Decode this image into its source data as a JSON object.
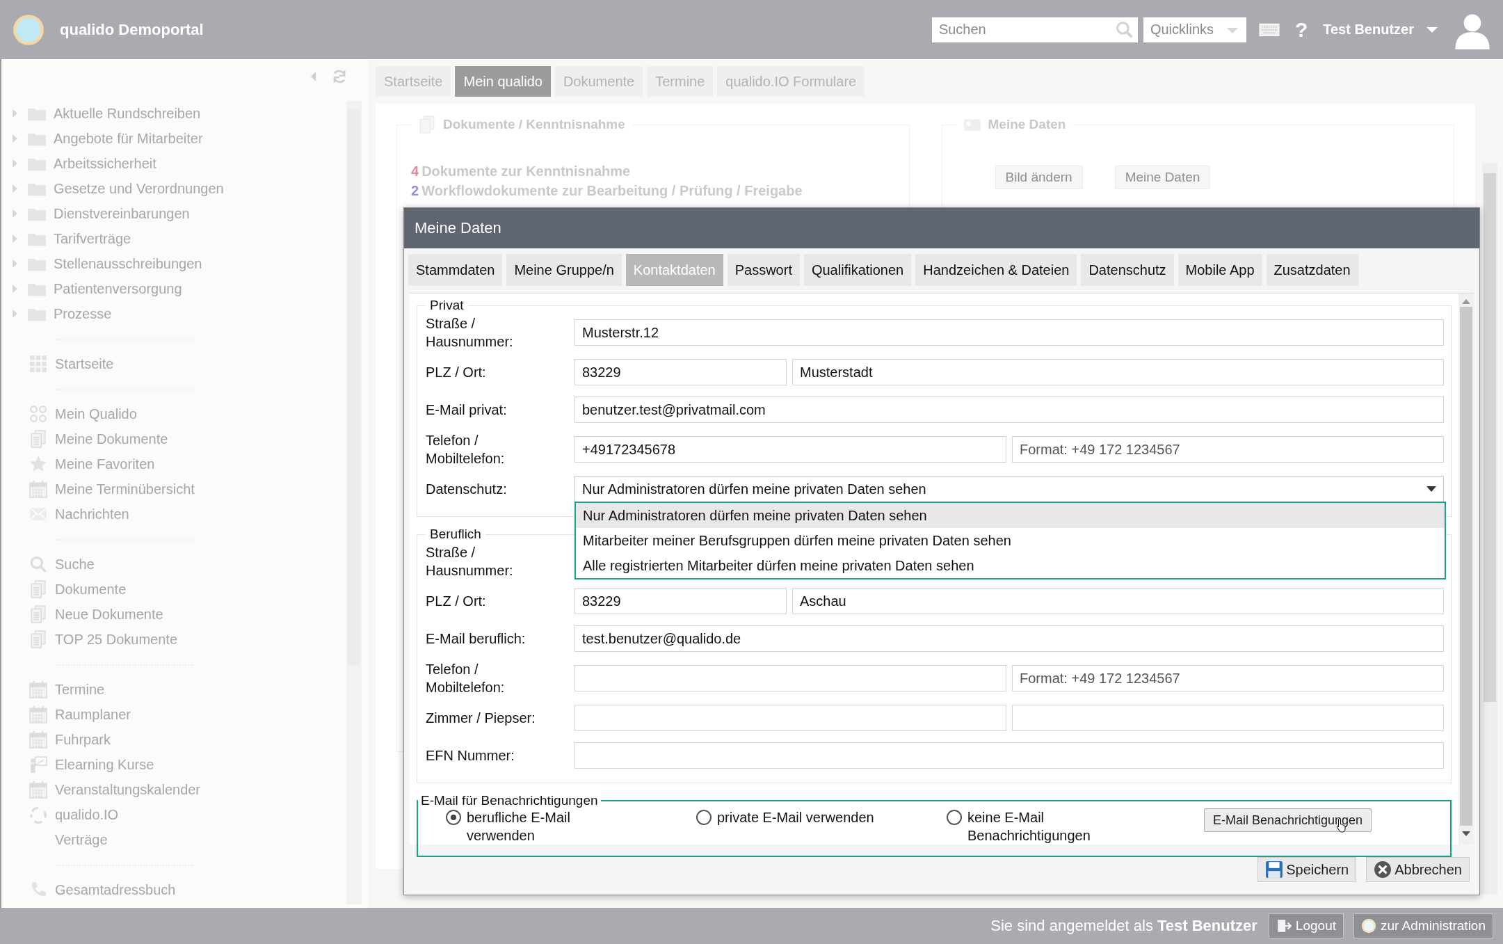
{
  "header": {
    "app_title": "qualido Demoportal",
    "search_placeholder": "Suchen",
    "quicklinks": "Quicklinks",
    "help": "?",
    "user": "Test Benutzer"
  },
  "sidebar": {
    "folders": [
      "Aktuelle Rundschreiben",
      "Angebote für Mitarbeiter",
      "Arbeitssicherheit",
      "Gesetze und Verordnungen",
      "Dienstvereinbarungen",
      "Tarifverträge",
      "Stellenausschreibungen",
      "Patientenversorgung",
      "Prozesse"
    ],
    "sections": [
      [
        {
          "label": "Startseite",
          "kind": "grid"
        }
      ],
      [
        {
          "label": "Mein Qualido",
          "kind": "circles"
        },
        {
          "label": "Meine Dokumente",
          "kind": "docs"
        },
        {
          "label": "Meine Favoriten",
          "kind": "star"
        },
        {
          "label": "Meine Terminübersicht",
          "kind": "calendar"
        },
        {
          "label": "Nachrichten",
          "kind": "mail"
        }
      ],
      [
        {
          "label": "Suche",
          "kind": "search"
        },
        {
          "label": "Dokumente",
          "kind": "docs"
        },
        {
          "label": "Neue Dokumente",
          "kind": "docs"
        },
        {
          "label": "TOP 25 Dokumente",
          "kind": "docs"
        }
      ],
      [
        {
          "label": "Termine",
          "kind": "calendar"
        },
        {
          "label": "Raumplaner",
          "kind": "calendar"
        },
        {
          "label": "Fuhrpark",
          "kind": "calendar"
        },
        {
          "label": "Elearning Kurse",
          "kind": "board"
        },
        {
          "label": "Veranstaltungskalender",
          "kind": "calendar"
        },
        {
          "label": "qualido.IO",
          "kind": "cycle"
        },
        {
          "label": "Verträge",
          "kind": "none"
        }
      ],
      [
        {
          "label": "Gesamtadressbuch",
          "kind": "phone"
        }
      ]
    ]
  },
  "main_tabs": [
    {
      "label": "Startseite",
      "selected": false
    },
    {
      "label": "Mein qualido",
      "selected": true
    },
    {
      "label": "Dokumente",
      "selected": false
    },
    {
      "label": "Termine",
      "selected": false
    },
    {
      "label": "qualido.IO Formulare",
      "selected": false
    }
  ],
  "panels": [
    {
      "title": "Dokumente / Kenntnisnahme",
      "kind": "docs",
      "lines": [
        {
          "count": "4",
          "text": "Dokumente zur Kenntnisnahme",
          "color": "#e58a98"
        },
        {
          "count": "2",
          "text": "Workflowdokumente zur Bearbeitung / Prüfung / Freigabe",
          "color": "#8f8fe0"
        }
      ]
    },
    {
      "title": "Meine Daten",
      "kind": "card",
      "buttons": [
        "Bild ändern",
        "Meine Daten"
      ]
    }
  ],
  "modal": {
    "title": "Meine Daten",
    "tabs": [
      {
        "label": "Stammdaten",
        "selected": false
      },
      {
        "label": "Meine Gruppe/n",
        "selected": false
      },
      {
        "label": "Kontaktdaten",
        "selected": true
      },
      {
        "label": "Passwort",
        "selected": false
      },
      {
        "label": "Qualifikationen",
        "selected": false
      },
      {
        "label": "Handzeichen & Dateien",
        "selected": false
      },
      {
        "label": "Datenschutz",
        "selected": false
      },
      {
        "label": "Mobile App",
        "selected": false
      },
      {
        "label": "Zusatzdaten",
        "selected": false
      }
    ],
    "sections": [
      {
        "legend": "Privat",
        "rows": [
          {
            "kind": "text",
            "label": "Straße / Hausnummer:",
            "value": "Musterstr.12"
          },
          {
            "kind": "zip",
            "label": "PLZ / Ort:",
            "value": "83229",
            "second_value": "Musterstadt"
          },
          {
            "kind": "text",
            "label": "E-Mail privat:",
            "value": "benutzer.test@privatmail.com"
          },
          {
            "kind": "pair",
            "label": "Telefon / Mobiltelefon:",
            "value": "+49172345678",
            "second_placeholder": "Format: +49 172 1234567"
          },
          {
            "kind": "select",
            "label": "Datenschutz:",
            "value": "Nur Administratoren dürfen meine privaten Daten sehen",
            "expanded": true,
            "options": [
              {
                "label": "Nur Administratoren dürfen meine privaten Daten sehen",
                "selected": true
              },
              {
                "label": "Mitarbeiter meiner Berufsgruppen dürfen meine privaten Daten sehen",
                "selected": false
              },
              {
                "label": "Alle registrierten Mitarbeiter dürfen meine privaten Daten sehen",
                "selected": false
              }
            ]
          }
        ]
      },
      {
        "legend": "Beruflich",
        "rows": [
          {
            "kind": "label",
            "label": "Straße / Hausnummer:"
          },
          {
            "kind": "zip",
            "label": "PLZ / Ort:",
            "value": "83229",
            "second_value": "Aschau"
          },
          {
            "kind": "text",
            "label": "E-Mail beruflich:",
            "value": "test.benutzer@qualido.de"
          },
          {
            "kind": "pair",
            "label": "Telefon / Mobiltelefon:",
            "second_placeholder": "Format: +49 172 1234567"
          },
          {
            "kind": "pair",
            "label": "Zimmer / Piepser:"
          },
          {
            "kind": "text",
            "label": "EFN Nummer:"
          }
        ]
      }
    ],
    "notifications": {
      "legend": "E-Mail für Benachrichtigungen",
      "options": [
        {
          "label": "berufliche E-Mail verwenden",
          "selected": true
        },
        {
          "label": "private E-Mail verwenden",
          "selected": false
        },
        {
          "label": "keine E-Mail Benachrichtigungen",
          "selected": false
        }
      ],
      "button": "E-Mail Benachrichtigungen"
    },
    "buttons": [
      {
        "label": "Speichern",
        "kind": "save"
      },
      {
        "label": "Abbrechen",
        "kind": "cancel"
      }
    ]
  },
  "status_bar": {
    "text": "Sie sind angemeldet als **Test Benutzer**",
    "logout": "Logout",
    "admin": "zur Administration"
  }
}
